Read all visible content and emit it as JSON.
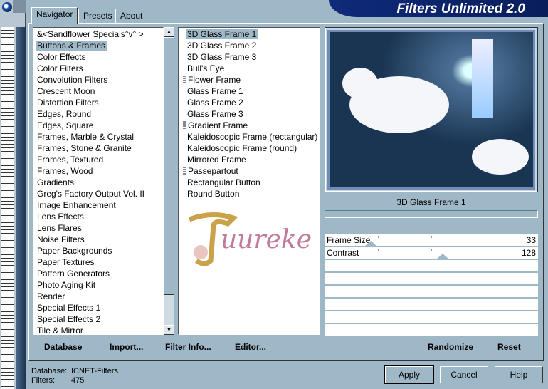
{
  "window": {
    "title": "Filters Unlimited 2.0"
  },
  "tabs": [
    {
      "label": "Navigator",
      "active": true
    },
    {
      "label": "Presets"
    },
    {
      "label": "About"
    }
  ],
  "categories": {
    "selected": 1,
    "items": [
      "&<Sandflower Specials°v° >",
      "Buttons & Frames",
      "Color Effects",
      "Color Filters",
      "Convolution Filters",
      "Crescent Moon",
      "Distortion Filters",
      "Edges, Round",
      "Edges, Square",
      "Frames, Marble & Crystal",
      "Frames, Stone & Granite",
      "Frames, Textured",
      "Frames, Wood",
      "Gradients",
      "Greg's Factory Output Vol. II",
      "Image Enhancement",
      "Lens Effects",
      "Lens Flares",
      "Noise Filters",
      "Paper Backgrounds",
      "Paper Textures",
      "Pattern Generators",
      "Photo Aging Kit",
      "Render",
      "Special Effects 1",
      "Special Effects 2",
      "Tile & Mirror"
    ]
  },
  "filters": {
    "selected": 0,
    "items": [
      {
        "label": "3D Glass Frame 1"
      },
      {
        "label": "3D Glass Frame 2"
      },
      {
        "label": "3D Glass Frame 3"
      },
      {
        "label": "Bull's Eye"
      },
      {
        "label": "Flower Frame",
        "grip": true
      },
      {
        "label": "Glass Frame 1"
      },
      {
        "label": "Glass Frame 2"
      },
      {
        "label": "Glass Frame 3"
      },
      {
        "label": "Gradient Frame",
        "grip": true
      },
      {
        "label": "Kaleidoscopic Frame (rectangular)"
      },
      {
        "label": "Kaleidoscopic Frame (round)"
      },
      {
        "label": "Mirrored Frame"
      },
      {
        "label": "Passepartout",
        "grip": true
      },
      {
        "label": "Rectangular Button"
      },
      {
        "label": "Round Button"
      }
    ]
  },
  "watermark": "Tuureke",
  "preview": {
    "caption": "3D Glass Frame 1"
  },
  "params": [
    {
      "label": "Frame Size",
      "value": "33",
      "range_max": 255
    },
    {
      "label": "Contrast",
      "value": "128",
      "range_max": 255
    }
  ],
  "actions": {
    "database": "Database",
    "import": "Import...",
    "filter_info": "Filter Info...",
    "editor": "Editor...",
    "randomize": "Randomize",
    "reset": "Reset"
  },
  "status": {
    "database_label": "Database:",
    "database_value": "ICNET-Filters",
    "filters_label": "Filters:",
    "filters_value": "475"
  },
  "buttons": {
    "apply": "Apply",
    "cancel": "Cancel",
    "help": "Help"
  }
}
